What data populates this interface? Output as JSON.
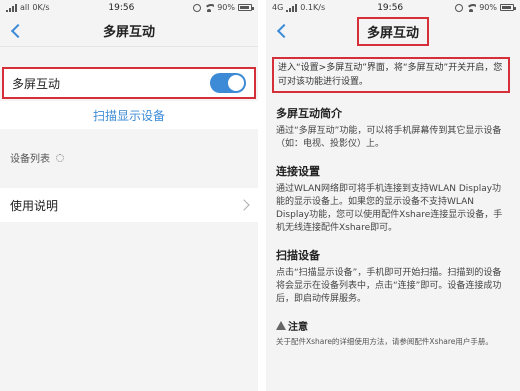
{
  "left": {
    "status": {
      "signal_text": "all",
      "speed": "0K/s",
      "time": "19:56",
      "battery": "90%"
    },
    "title": "多屏互动",
    "toggle_label": "多屏互动",
    "toggle_on": true,
    "scan_label": "扫描显示设备",
    "device_list_label": "设备列表",
    "instructions_label": "使用说明"
  },
  "right": {
    "status": {
      "network": "4G",
      "speed": "0.1K/s",
      "time": "19:56",
      "battery": "90%"
    },
    "title": "多屏互动",
    "intro": "进入“设置>多屏互动”界面，将“多屏互动”开关开启，您可对该功能进行设置。",
    "sections": [
      {
        "heading": "多屏互动简介",
        "body": "通过“多屏互动”功能，可以将手机屏幕传到其它显示设备（如：电视、投影仪）上。"
      },
      {
        "heading": "连接设置",
        "body": "通过WLAN网络即可将手机连接到支持WLAN Display功能的显示设备上。如果您的显示设备不支持WLAN Display功能，您可以使用配件Xshare连接显示设备，手机无线连接配件Xshare即可。"
      },
      {
        "heading": "扫描设备",
        "body": "点击“扫描显示设备”，手机即可开始扫描。扫描到的设备将会显示在设备列表中，点击“连接”即可。设备连接成功后，即启动传屏服务。"
      }
    ],
    "note_heading": "注意",
    "note_body": "关于配件Xshare的详细使用方法，请参阅配件Xshare用户手册。"
  },
  "colors": {
    "accent": "#3d8bd6",
    "highlight": "#d52f3a"
  }
}
